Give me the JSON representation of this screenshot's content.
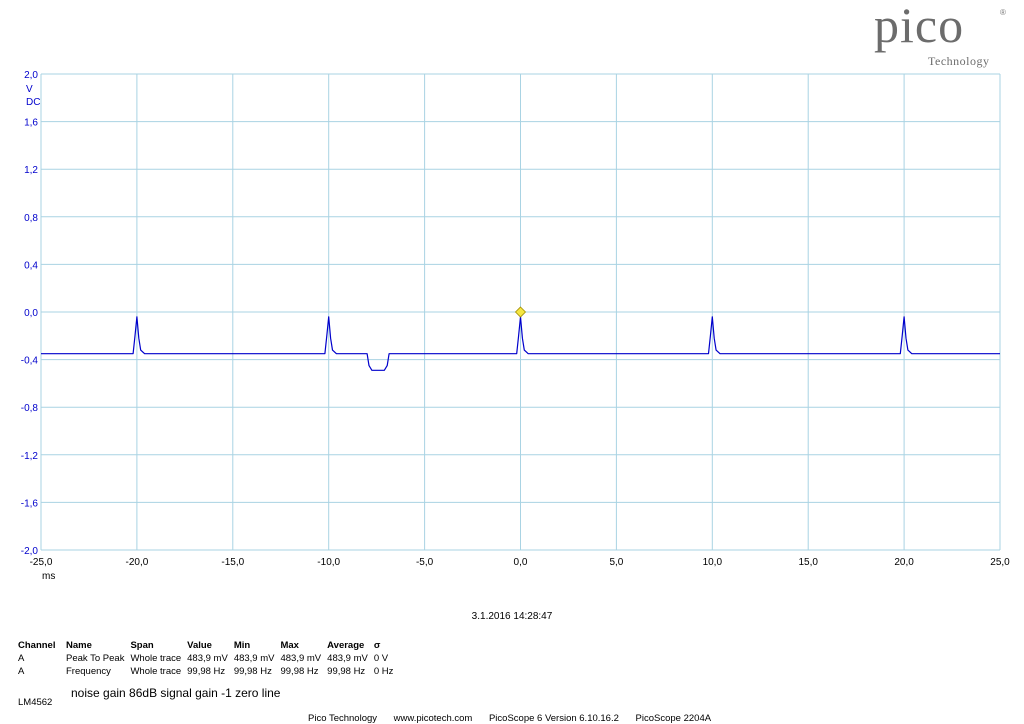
{
  "logo": {
    "word": "pico",
    "registered": "®",
    "sub": "Technology"
  },
  "chart_data": {
    "type": "line",
    "x_unit": "ms",
    "y_unit": "V",
    "y_coupling": "DC",
    "xlim": [
      -25,
      25
    ],
    "ylim": [
      -2,
      2
    ],
    "x_ticks": [
      -25,
      -20,
      -15,
      -10,
      -5,
      0,
      5,
      10,
      15,
      20,
      25
    ],
    "x_tick_labels": [
      "-25,0",
      "-20,0",
      "-15,0",
      "-10,0",
      "-5,0",
      "0,0",
      "5,0",
      "10,0",
      "15,0",
      "20,0",
      "25,0"
    ],
    "y_ticks": [
      2,
      1.6,
      1.2,
      0.8,
      0.4,
      0,
      -0.4,
      -0.8,
      -1.2,
      -1.6,
      -2
    ],
    "y_tick_labels": [
      "2,0",
      "1,6",
      "1,2",
      "0,8",
      "0,4",
      "0,0",
      "-0,4",
      "-0,8",
      "-1,2",
      "-1,6",
      "-2,0"
    ],
    "grid": true,
    "grid_color": "#a9d3e3",
    "trace_color": "#0000cc",
    "axis_label_color": "#0000cc",
    "trigger_marker": {
      "x": 0,
      "y": 0,
      "color": "#f5e642"
    },
    "series": [
      {
        "x": [
          -25,
          -20.2,
          -20.1,
          -20.0,
          -19.9,
          -19.8,
          -19.6,
          -10.2,
          -10.1,
          -10.0,
          -9.9,
          -9.8,
          -9.6,
          -8.0,
          -7.9,
          -7.75,
          -7.1,
          -6.95,
          -6.85,
          -0.2,
          -0.1,
          0.0,
          0.1,
          0.2,
          0.4,
          9.8,
          9.9,
          10.0,
          10.1,
          10.2,
          10.4,
          19.8,
          19.9,
          20.0,
          20.1,
          20.2,
          20.4,
          25
        ],
        "y": [
          -0.35,
          -0.35,
          -0.2,
          -0.04,
          -0.22,
          -0.32,
          -0.35,
          -0.35,
          -0.2,
          -0.04,
          -0.22,
          -0.32,
          -0.35,
          -0.35,
          -0.45,
          -0.49,
          -0.49,
          -0.45,
          -0.35,
          -0.35,
          -0.2,
          -0.04,
          -0.22,
          -0.32,
          -0.35,
          -0.35,
          -0.2,
          -0.04,
          -0.22,
          -0.32,
          -0.35,
          -0.35,
          -0.2,
          -0.04,
          -0.22,
          -0.32,
          -0.35,
          -0.35
        ]
      }
    ]
  },
  "timestamp": "3.1.2016 14:28:47",
  "measurements": {
    "headers": [
      "Channel",
      "Name",
      "Span",
      "Value",
      "Min",
      "Max",
      "Average",
      "σ"
    ],
    "rows": [
      [
        "A",
        "Peak To Peak",
        "Whole trace",
        "483,9 mV",
        "483,9 mV",
        "483,9 mV",
        "483,9 mV",
        "0 V"
      ],
      [
        "A",
        "Frequency",
        "Whole trace",
        "99,98 Hz",
        "99,98 Hz",
        "99,98 Hz",
        "99,98 Hz",
        "0 Hz"
      ]
    ]
  },
  "device_label": "LM4562",
  "note": "noise gain 86dB  signal gain -1  zero line",
  "footer": [
    "Pico Technology",
    "www.picotech.com",
    "PicoScope 6 Version 6.10.16.2",
    "PicoScope 2204A"
  ]
}
